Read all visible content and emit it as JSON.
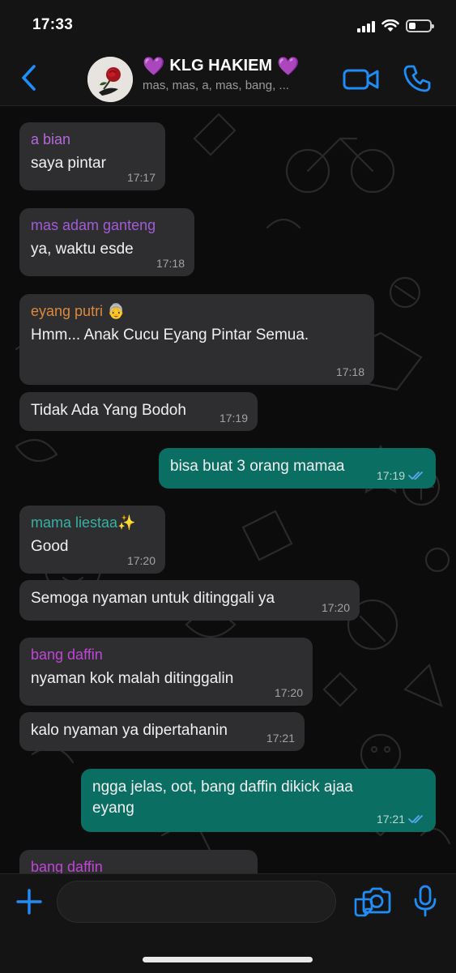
{
  "status_bar": {
    "time": "17:33"
  },
  "header": {
    "group_name": "KLG HAKIEM",
    "title_emoji": "💜",
    "members": "mas, mas, a, mas, bang, ..."
  },
  "messages": [
    {
      "sender": "a bian",
      "sender_color": "#b36ad8",
      "text": "saya pintar",
      "time": "17:17",
      "outgoing": false
    },
    {
      "sender": "mas adam ganteng",
      "sender_color": "#a25cd6",
      "text": "ya, waktu esde",
      "time": "17:18",
      "outgoing": false
    },
    {
      "sender": "eyang putri 👵",
      "sender_color": "#d98a3b",
      "text": "Hmm... Anak Cucu Eyang Pintar Semua.",
      "time": "17:18",
      "outgoing": false
    },
    {
      "sender": "",
      "text": "Tidak Ada Yang Bodoh",
      "time": "17:19",
      "outgoing": false
    },
    {
      "sender": "",
      "text": "bisa buat 3 orang mamaa",
      "time": "17:19",
      "outgoing": true
    },
    {
      "sender": "mama liestaa✨",
      "sender_color": "#35b2a3",
      "text": "Good",
      "time": "17:20",
      "outgoing": false
    },
    {
      "sender": "",
      "text": "Semoga nyaman untuk ditinggali ya",
      "time": "17:20",
      "outgoing": false
    },
    {
      "sender": "bang daffin",
      "sender_color": "#c046d6",
      "text": "nyaman kok malah ditinggalin",
      "time": "17:20",
      "outgoing": false
    },
    {
      "sender": "",
      "text": "kalo nyaman ya dipertahanin",
      "time": "17:21",
      "outgoing": false
    },
    {
      "sender": "",
      "text_line1": "ngga jelas, oot, bang daffin dikick ajaa",
      "text_line2": "eyang",
      "time": "17:21",
      "outgoing": true
    },
    {
      "sender": "bang daffin",
      "sender_color": "#c046d6",
      "text": "",
      "time": "",
      "outgoing": false
    }
  ],
  "colors": {
    "accent": "#1f8df5",
    "outgoing_bubble": "#0b6e63",
    "incoming_bubble": "#2e2e30",
    "read_ticks": "#5aa8f0"
  },
  "icons": {
    "back": "chevron-left-icon",
    "video": "video-call-icon",
    "phone": "phone-icon",
    "add": "plus-icon",
    "sticker": "sticker-icon",
    "camera": "camera-icon",
    "mic": "microphone-icon"
  }
}
